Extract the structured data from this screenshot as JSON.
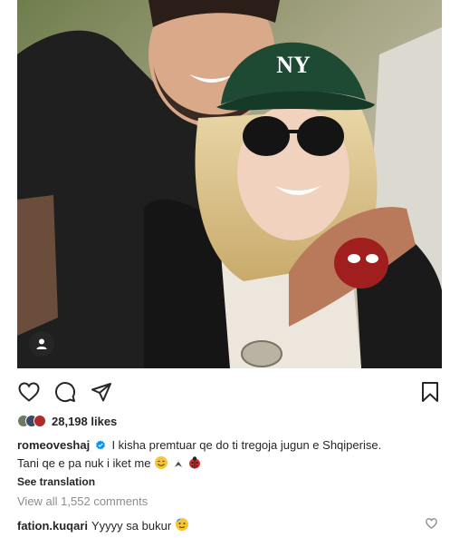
{
  "post": {
    "likes_count": "28,198 likes",
    "caption": {
      "username": "romeoveshaj",
      "line1": "I kisha premtuar qe do ti tregoja jugun e Shqiperise.",
      "line2": "Tani qe e pa nuk i iket me"
    },
    "see_translation": "See translation",
    "view_comments": "View all 1,552 comments",
    "comment": {
      "username": "fation.kuqari",
      "text": "Yyyyy sa bukur"
    }
  },
  "icons": [
    "heart-icon",
    "comment-icon",
    "share-icon",
    "bookmark-icon",
    "user-tag-icon",
    "verified-badge-icon"
  ],
  "colors": {
    "text": "#262626",
    "secondary": "#8e8e8e",
    "verified": "#0095f6"
  }
}
